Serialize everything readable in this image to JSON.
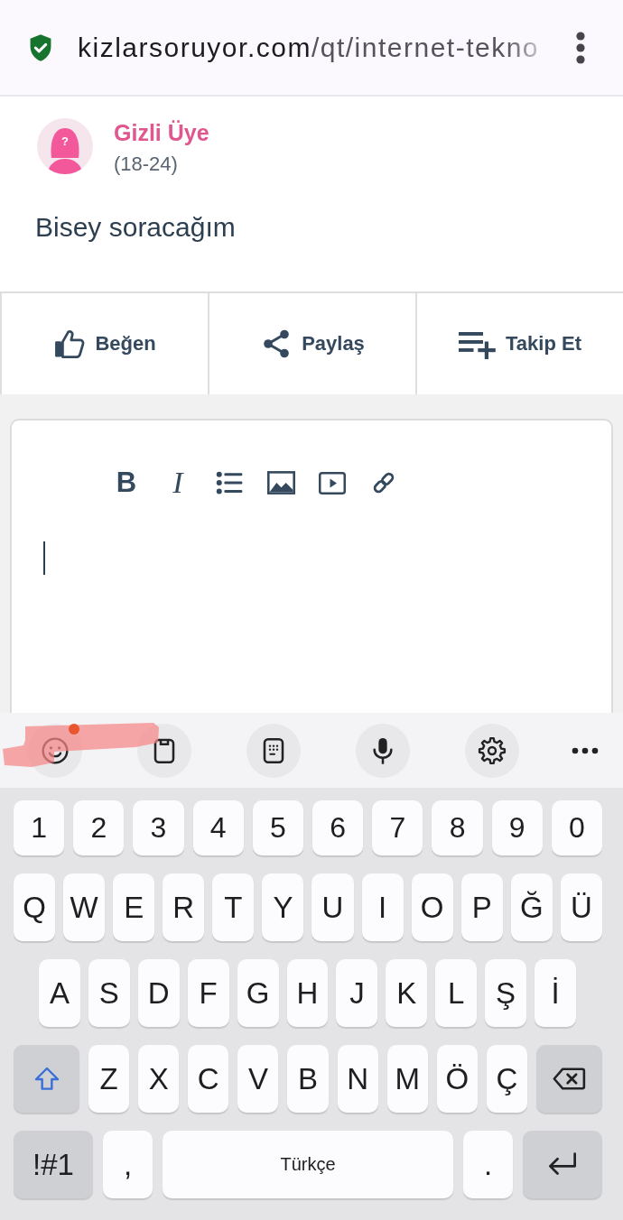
{
  "browser_bar": {
    "secure": true,
    "url_host": "kizlarsoruyor.com",
    "url_path": "/qt/internet-tekno"
  },
  "post": {
    "avatar_symbol": "?",
    "author": "Gizli Üye",
    "age_range": "(18-24)",
    "text": "Bisey soracağım"
  },
  "actions": [
    {
      "kind": "like",
      "label": "Beğen"
    },
    {
      "kind": "share",
      "label": "Paylaş"
    },
    {
      "kind": "follow",
      "label": "Takip Et"
    }
  ],
  "editor": {
    "tools": [
      {
        "kind": "bold",
        "glyph": "B"
      },
      {
        "kind": "italic",
        "glyph": "I"
      },
      {
        "kind": "bullet_list"
      },
      {
        "kind": "image"
      },
      {
        "kind": "video"
      },
      {
        "kind": "link"
      }
    ],
    "caret": true
  },
  "keyboard": {
    "toolbar": [
      {
        "kind": "emoji",
        "badge_dot": true,
        "highlighted": true
      },
      {
        "kind": "clipboard"
      },
      {
        "kind": "keypad"
      },
      {
        "kind": "mic"
      },
      {
        "kind": "settings"
      },
      {
        "kind": "more"
      }
    ],
    "rows": [
      {
        "keys": [
          {
            "kind": "char",
            "label": "1"
          },
          {
            "kind": "char",
            "label": "2"
          },
          {
            "kind": "char",
            "label": "3"
          },
          {
            "kind": "char",
            "label": "4"
          },
          {
            "kind": "char",
            "label": "5"
          },
          {
            "kind": "char",
            "label": "6"
          },
          {
            "kind": "char",
            "label": "7"
          },
          {
            "kind": "char",
            "label": "8"
          },
          {
            "kind": "char",
            "label": "9"
          },
          {
            "kind": "char",
            "label": "0"
          }
        ]
      },
      {
        "keys": [
          {
            "kind": "char",
            "label": "Q"
          },
          {
            "kind": "char",
            "label": "W"
          },
          {
            "kind": "char",
            "label": "E"
          },
          {
            "kind": "char",
            "label": "R"
          },
          {
            "kind": "char",
            "label": "T"
          },
          {
            "kind": "char",
            "label": "Y"
          },
          {
            "kind": "char",
            "label": "U"
          },
          {
            "kind": "char",
            "label": "I"
          },
          {
            "kind": "char",
            "label": "O"
          },
          {
            "kind": "char",
            "label": "P"
          },
          {
            "kind": "char",
            "label": "Ğ"
          },
          {
            "kind": "char",
            "label": "Ü"
          }
        ]
      },
      {
        "keys": [
          {
            "kind": "char",
            "label": "A"
          },
          {
            "kind": "char",
            "label": "S"
          },
          {
            "kind": "char",
            "label": "D"
          },
          {
            "kind": "char",
            "label": "F"
          },
          {
            "kind": "char",
            "label": "G"
          },
          {
            "kind": "char",
            "label": "H"
          },
          {
            "kind": "char",
            "label": "J"
          },
          {
            "kind": "char",
            "label": "K"
          },
          {
            "kind": "char",
            "label": "L"
          },
          {
            "kind": "char",
            "label": "Ş"
          },
          {
            "kind": "char",
            "label": "İ"
          }
        ]
      },
      {
        "keys": [
          {
            "kind": "shift",
            "on": true
          },
          {
            "kind": "char",
            "label": "Z"
          },
          {
            "kind": "char",
            "label": "X"
          },
          {
            "kind": "char",
            "label": "C"
          },
          {
            "kind": "char",
            "label": "V"
          },
          {
            "kind": "char",
            "label": "B"
          },
          {
            "kind": "char",
            "label": "N"
          },
          {
            "kind": "char",
            "label": "M"
          },
          {
            "kind": "char",
            "label": "Ö"
          },
          {
            "kind": "char",
            "label": "Ç"
          },
          {
            "kind": "backspace"
          }
        ]
      },
      {
        "keys": [
          {
            "kind": "symbols",
            "label": "!#1"
          },
          {
            "kind": "char",
            "label": ","
          },
          {
            "kind": "space",
            "label": "Türkçe"
          },
          {
            "kind": "char",
            "label": "."
          },
          {
            "kind": "enter"
          }
        ]
      }
    ]
  }
}
